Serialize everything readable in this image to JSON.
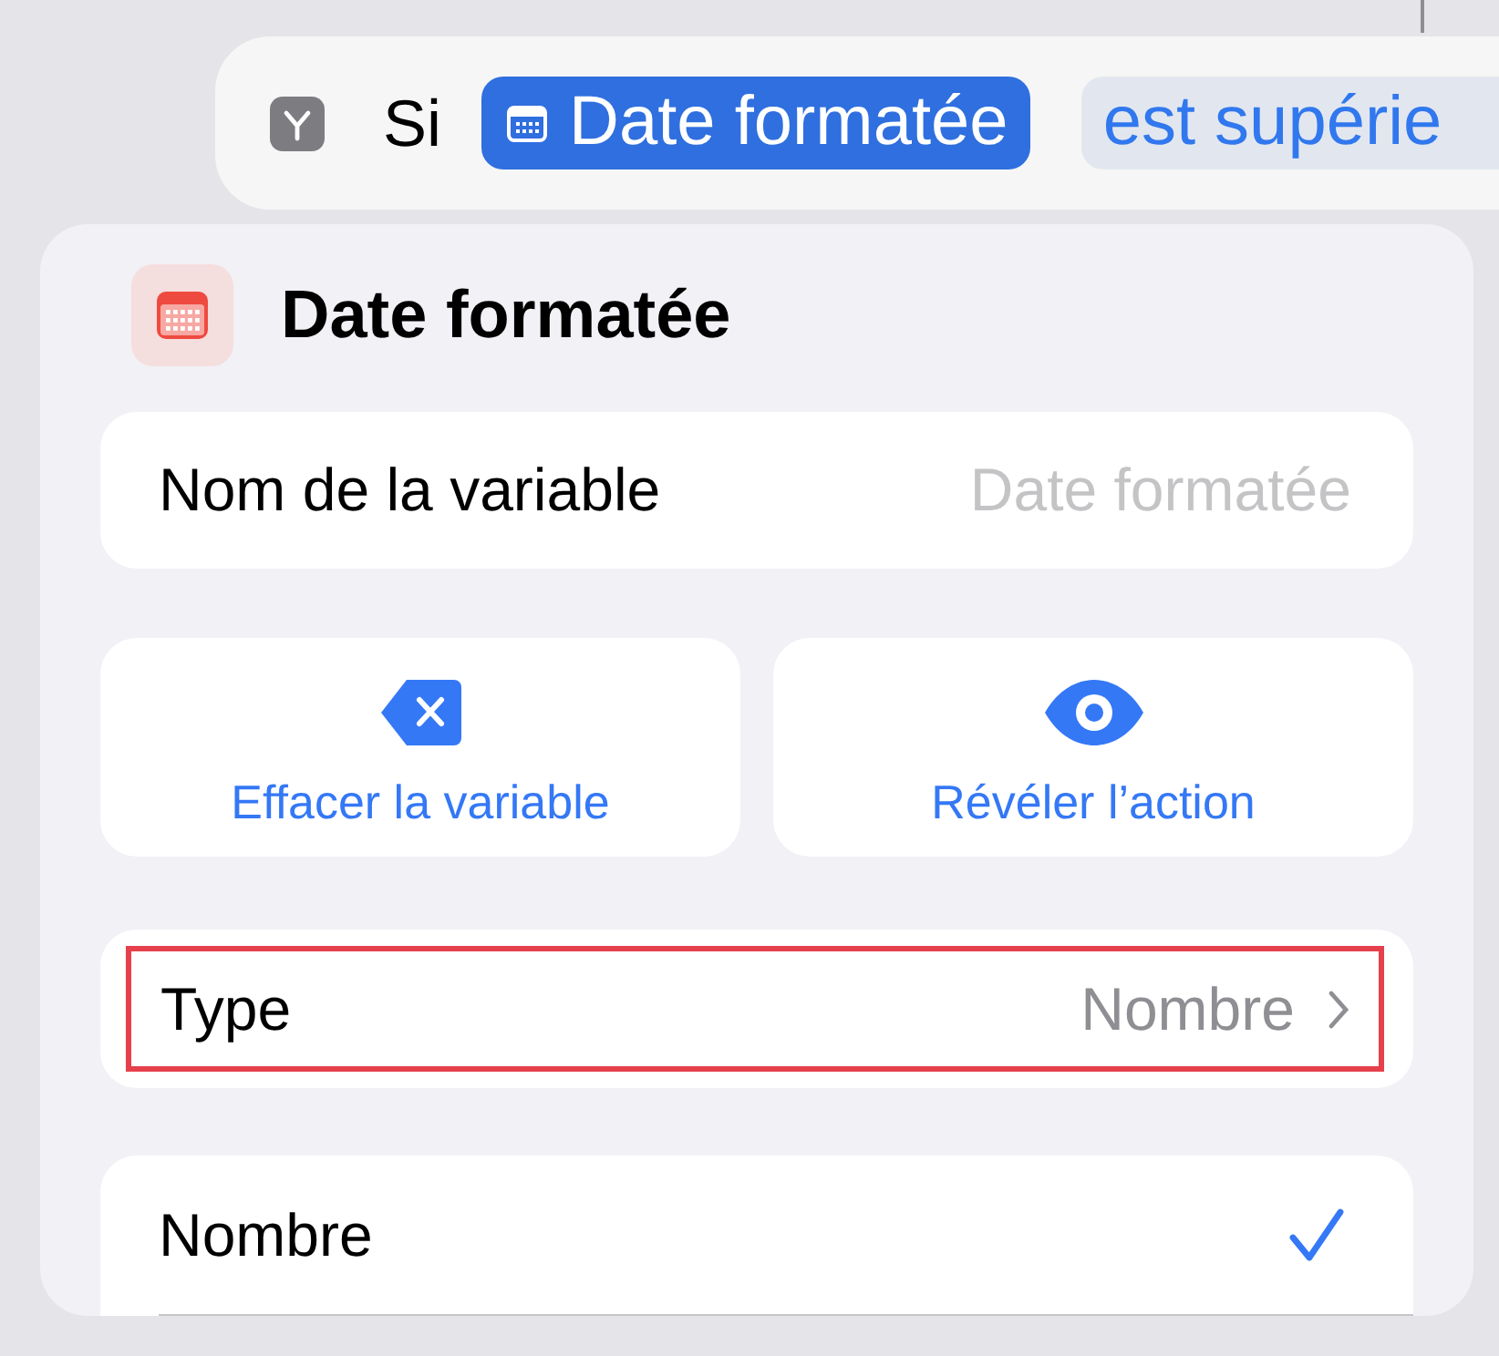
{
  "condition_bar": {
    "keyword": "Si",
    "variable": "Date formatée",
    "operator": "est supérie"
  },
  "popover": {
    "title": "Date formatée",
    "name_row": {
      "label": "Nom de la variable",
      "placeholder": "Date formatée"
    },
    "actions": [
      {
        "kind": "clear",
        "label": "Effacer la variable"
      },
      {
        "kind": "reveal",
        "label": "Révéler l’action"
      }
    ],
    "type_row": {
      "label": "Type",
      "value": "Nombre",
      "highlighted": true
    },
    "options": [
      {
        "label": "Nombre",
        "selected": true
      }
    ]
  }
}
